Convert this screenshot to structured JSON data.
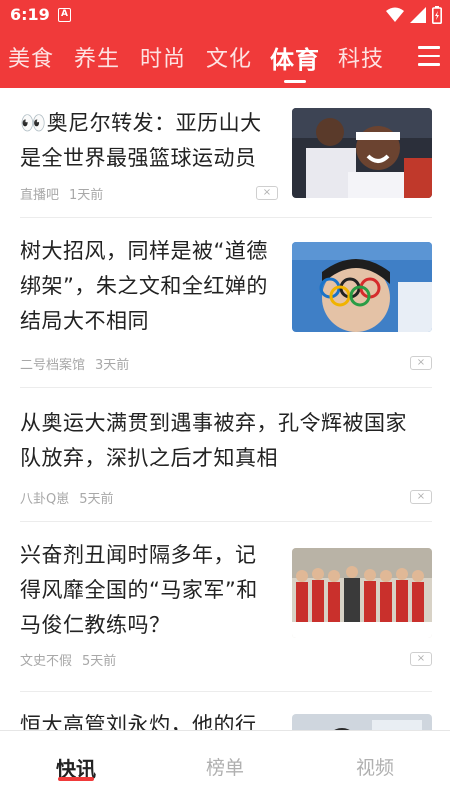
{
  "status_bar": {
    "time": "6:19",
    "notification_badge": "A"
  },
  "tabs": [
    {
      "label": "美食"
    },
    {
      "label": "养生"
    },
    {
      "label": "时尚"
    },
    {
      "label": "文化"
    },
    {
      "label": "体育",
      "active": true
    },
    {
      "label": "科技"
    }
  ],
  "feed": [
    {
      "title_line1": "👀奥尼尔转发：亚历山大",
      "title_line2": "是全世界最强篮球运动员",
      "source": "直播吧",
      "time": "1天前",
      "has_image": true
    },
    {
      "title_line1": "树大招风，同样是被“道德",
      "title_line2": "绑架”，朱之文和全红婵的",
      "title_line3": "结局大不相同",
      "source": "二号档案馆",
      "time": "3天前",
      "has_image": true
    },
    {
      "title_line1": "从奥运大满贯到遇事被弃，孔令辉被国家",
      "title_line2": "队放弃，深扒之后才知真相",
      "source": "八卦Q崽",
      "time": "5天前",
      "has_image": false
    },
    {
      "title_line1": "兴奋剂丑闻时隔多年，记",
      "title_line2": "得风靡全国的“马家军”和",
      "title_line3": "马俊仁教练吗？",
      "source": "文史不假",
      "time": "5天前",
      "has_image": true
    },
    {
      "title_line1": "恒大高管刘永灼，他的行",
      "has_image": true
    }
  ],
  "close_symbol": "×",
  "bottom_nav": [
    {
      "label": "快讯",
      "active": true
    },
    {
      "label": "榜单"
    },
    {
      "label": "视频"
    }
  ],
  "colors": {
    "brand_red": "#f03a3a",
    "title_text": "#222222",
    "meta_text": "#a8a8a8"
  }
}
